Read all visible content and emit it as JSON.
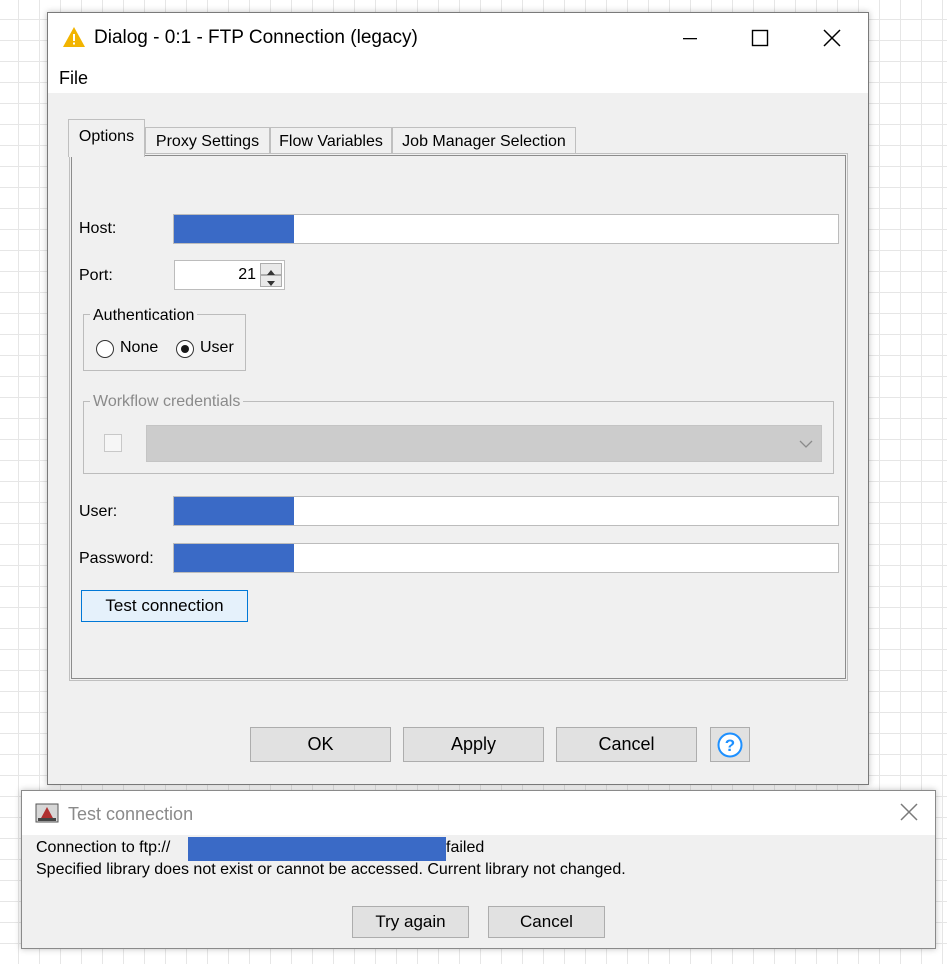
{
  "dialog": {
    "title": "Dialog - 0:1 - FTP Connection (legacy)",
    "menu": {
      "file": "File"
    },
    "tabs": [
      "Options",
      "Proxy Settings",
      "Flow Variables",
      "Job Manager Selection"
    ],
    "host_label": "Host:",
    "port_label": "Port:",
    "port_value": "21",
    "auth_group_title": "Authentication",
    "auth_none": "None",
    "auth_user": "User",
    "auth_selected": "User",
    "workflow_creds_title": "Workflow credentials",
    "user_label": "User:",
    "password_label": "Password:",
    "test_button": "Test connection",
    "ok_button": "OK",
    "apply_button": "Apply",
    "cancel_button": "Cancel",
    "help_glyph": "?"
  },
  "popup": {
    "title": "Test connection",
    "message_prefix": "Connection to ftp://",
    "message_suffix": "failed",
    "message_line2": "Specified library does not exist or cannot be accessed. Current library not changed.",
    "try_again_button": "Try again",
    "cancel_button": "Cancel"
  },
  "colors": {
    "redaction": "#3a6ac6",
    "warning_icon": "#f2b400",
    "help_icon": "#1e90ff",
    "test_button_bg": "#e5f1fb",
    "test_button_border": "#0078d7"
  }
}
